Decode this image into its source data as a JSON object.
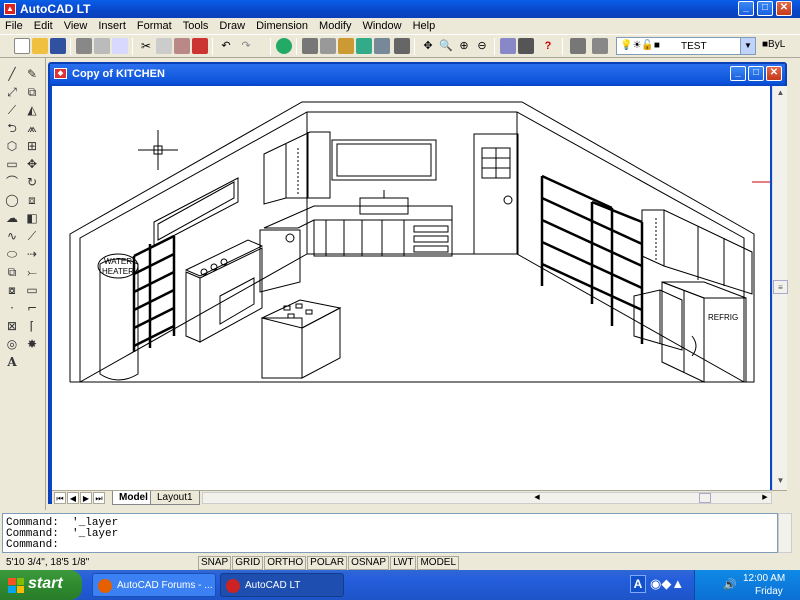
{
  "app": {
    "title": "AutoCAD LT",
    "icon": "autocad-logo-icon"
  },
  "menu": [
    "File",
    "Edit",
    "View",
    "Insert",
    "Format",
    "Tools",
    "Draw",
    "Dimension",
    "Modify",
    "Window",
    "Help"
  ],
  "toolbar": {
    "layer_name": "TEST",
    "linetype": "ByL"
  },
  "drawing": {
    "title": "Copy of KITCHEN",
    "labels": {
      "water_heater_1": "WATER",
      "water_heater_2": "HEATER",
      "refrig": "REFRIG"
    }
  },
  "tabs": {
    "model": "Model",
    "layout": "Layout1"
  },
  "command": {
    "lines": [
      "Command:  '_layer",
      "Command:  '_layer",
      "Command:"
    ]
  },
  "status": {
    "coords": "5'10 3/4\",  18'5 1/8\"",
    "toggles": [
      "SNAP",
      "GRID",
      "ORTHO",
      "POLAR",
      "OSNAP",
      "LWT",
      "MODEL"
    ]
  },
  "taskbar": {
    "start": "start",
    "tasks": [
      "AutoCAD Forums - ...",
      "AutoCAD LT"
    ],
    "time": "12:00 AM",
    "day": "Friday"
  },
  "colors": {
    "titlebar": "#0a50d8",
    "start": "#2f8a2f",
    "tray": "#0c6fd4"
  }
}
